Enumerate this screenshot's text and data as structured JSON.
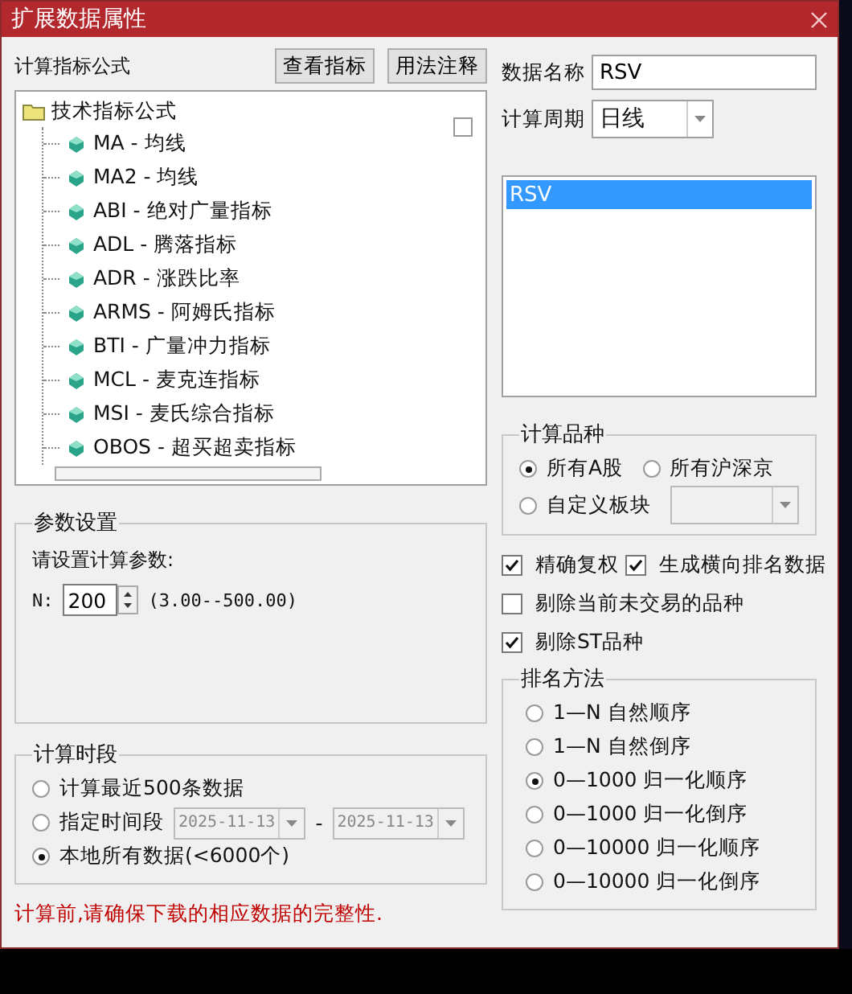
{
  "window": {
    "title": "扩展数据属性"
  },
  "formula_panel": {
    "label": "计算指标公式",
    "buttons": [
      "查看指标",
      "用法注释"
    ],
    "tree": {
      "label": "技术指标公式",
      "expanded": true,
      "children": [
        {
          "label": "MA - 均线"
        },
        {
          "label": "MA2 - 均线"
        },
        {
          "label": "ABI - 绝对广量指标"
        },
        {
          "label": "ADL - 腾落指标"
        },
        {
          "label": "ADR - 涨跌比率"
        },
        {
          "label": "ARMS - 阿姆氏指标"
        },
        {
          "label": "BTI - 广量冲力指标"
        },
        {
          "label": "MCL - 麦克连指标"
        },
        {
          "label": "MSI - 麦氏综合指标"
        },
        {
          "label": "OBOS - 超买超卖指标"
        }
      ]
    }
  },
  "params": {
    "title": "参数设置",
    "prompt": "请设置计算参数:",
    "name": "N:",
    "value": "200",
    "range": "(3.00--500.00)"
  },
  "period_section": {
    "title": "计算时段",
    "options": [
      {
        "label": "计算最近500条数据",
        "selected": false,
        "kind": "plain"
      },
      {
        "label": "指定时间段",
        "selected": false,
        "kind": "dates",
        "from": "2025-11-13",
        "separator": "-",
        "to": "2025-11-13"
      },
      {
        "label": "本地所有数据(<6000个)",
        "selected": true,
        "kind": "plain"
      }
    ]
  },
  "note": "计算前,请确保下载的相应数据的完整性.",
  "data_name": {
    "label": "数据名称",
    "value": "RSV"
  },
  "period": {
    "label": "计算周期",
    "value": "日线"
  },
  "data_list": [
    {
      "label": "RSV",
      "selected": true
    }
  ],
  "instruments": {
    "title": "计算品种",
    "options": [
      {
        "label": "所有A股",
        "selected": true
      },
      {
        "label": "所有沪深京",
        "selected": false
      },
      {
        "label": "自定义板块",
        "selected": false
      }
    ]
  },
  "check_rows": [
    {
      "items": [
        {
          "label": "精确复权",
          "checked": true
        },
        {
          "label": "生成横向排名数据",
          "checked": true
        }
      ]
    },
    {
      "items": [
        {
          "label": "剔除当前未交易的品种",
          "checked": false
        }
      ]
    },
    {
      "items": [
        {
          "label": "剔除ST品种",
          "checked": true
        }
      ]
    }
  ],
  "ranking": {
    "title": "排名方法",
    "options": [
      {
        "label": "1—N 自然顺序",
        "selected": false
      },
      {
        "label": "1—N 自然倒序",
        "selected": false
      },
      {
        "label": "0—1000 归一化顺序",
        "selected": true
      },
      {
        "label": "0—1000 归一化倒序",
        "selected": false
      },
      {
        "label": "0—10000 归一化顺序",
        "selected": false
      },
      {
        "label": "0—10000 归一化倒序",
        "selected": false
      }
    ]
  }
}
